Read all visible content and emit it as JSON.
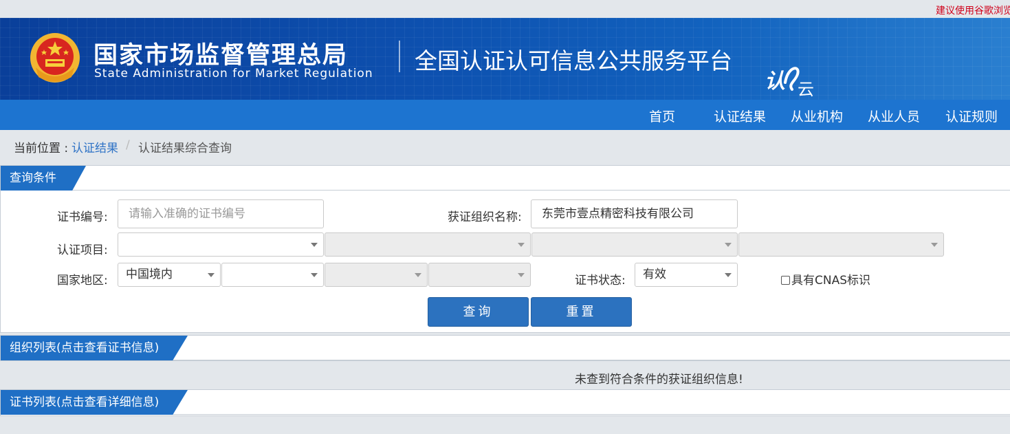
{
  "topbar": {
    "notice": "建议使用谷歌浏览器"
  },
  "header": {
    "agency_cn": "国家市场监督管理总局",
    "agency_en": "State Administration for Market Regulation",
    "platform": "全国认证认可信息公共服务平台",
    "logo_text": "认云"
  },
  "nav": {
    "items": [
      "首页",
      "认证结果",
      "从业机构",
      "从业人员",
      "认证规则"
    ]
  },
  "breadcrumb": {
    "label": "当前位置 :",
    "link": "认证结果",
    "separator": "/",
    "current": "认证结果综合查询"
  },
  "query": {
    "tab_title": "查询条件",
    "cert_no_label": "证书编号:",
    "cert_no_placeholder": "请输入准确的证书编号",
    "org_name_label": "获证组织名称:",
    "org_name_value": "东莞市壹点精密科技有限公司",
    "project_label": "认证项目:",
    "region_label": "国家地区:",
    "region_value": "中国境内",
    "status_label": "证书状态:",
    "status_value": "有效",
    "cnas_label": "具有CNAS标识",
    "search_button": "查询",
    "reset_button": "重置"
  },
  "org_list": {
    "tab_title": "组织列表(点击查看证书信息)",
    "empty_message": "未查到符合条件的获证组织信息!"
  },
  "cert_list": {
    "tab_title": "证书列表(点击查看详细信息)"
  },
  "colors": {
    "brand_blue": "#1d74d0",
    "button_blue": "#2c72bf",
    "link_blue": "#2f73c6",
    "notice_red": "#d0021b"
  }
}
